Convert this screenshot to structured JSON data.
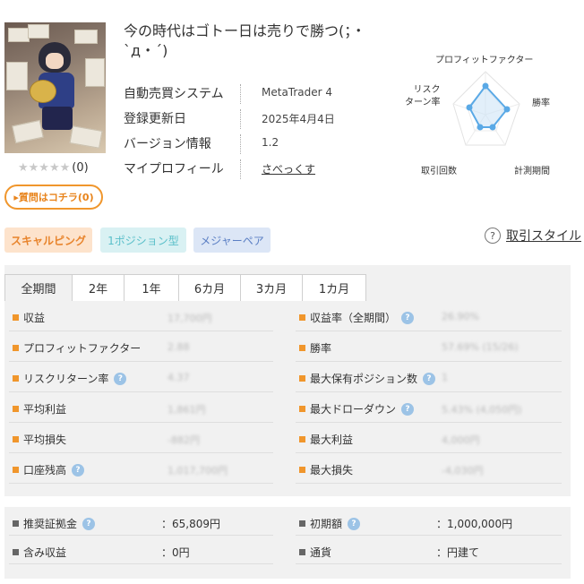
{
  "header": {
    "title": "今の時代はゴトー日は売りで勝つ(；・`д・´)",
    "rating_stars": "★★★★★",
    "rating_count": "(0)",
    "question_button": "▸質問はコチラ(0)"
  },
  "info": [
    {
      "key": "自動売買システム",
      "value": "MetaTrader 4"
    },
    {
      "key": "登録更新日",
      "value": "2025年4月4日"
    },
    {
      "key": "バージョン情報",
      "value": "1.2"
    },
    {
      "key": "マイプロフィール",
      "value": "さべっくす"
    }
  ],
  "radar": {
    "labels": {
      "profit_factor": "プロフィットファクター",
      "risk_return": "リスク\nターン率",
      "win_rate": "勝率",
      "trade_count": "取引回数",
      "period": "計測期間"
    }
  },
  "tags": [
    "スキャルピング",
    "1ポジション型",
    "メジャーペア"
  ],
  "style_link": {
    "icon": "?",
    "label": "取引スタイル"
  },
  "tabs": [
    "全期間",
    "2年",
    "1年",
    "6カ月",
    "3カ月",
    "1カ月"
  ],
  "stats": [
    {
      "left": {
        "label": "収益",
        "value": "17,700円",
        "hint": false
      },
      "right": {
        "label": "収益率（全期間）",
        "value": "26.90%",
        "hint": true
      }
    },
    {
      "left": {
        "label": "プロフィットファクター",
        "value": "2.88",
        "hint": false
      },
      "right": {
        "label": "勝率",
        "value": "57.69% (15/26)",
        "hint": false
      }
    },
    {
      "left": {
        "label": "リスクリターン率",
        "value": "4.37",
        "hint": true
      },
      "right": {
        "label": "最大保有ポジション数",
        "value": "1",
        "hint": true
      }
    },
    {
      "left": {
        "label": "平均利益",
        "value": "1,861円",
        "hint": false
      },
      "right": {
        "label": "最大ドローダウン",
        "value": "5.43% (4,050円)",
        "hint": true
      }
    },
    {
      "left": {
        "label": "平均損失",
        "value": "-882円",
        "hint": false
      },
      "right": {
        "label": "最大利益",
        "value": "4,000円",
        "hint": false
      }
    },
    {
      "left": {
        "label": "口座残高",
        "value": "1,017,700円",
        "hint": true
      },
      "right": {
        "label": "最大損失",
        "value": "-4,030円",
        "hint": false
      }
    }
  ],
  "stats2": [
    {
      "left": {
        "label": "推奨証拠金",
        "value": "：65,809円",
        "hint": true
      },
      "right": {
        "label": "初期額",
        "value": "：1,000,000円",
        "hint": true
      }
    },
    {
      "left": {
        "label": "含み収益",
        "value": "：0円",
        "hint": false
      },
      "right": {
        "label": "通貨",
        "value": "：円建て",
        "hint": false
      }
    }
  ],
  "colors": {
    "accent": "#f0962c",
    "hint": "#9cc3e6",
    "radar": "#5aa9e6"
  }
}
